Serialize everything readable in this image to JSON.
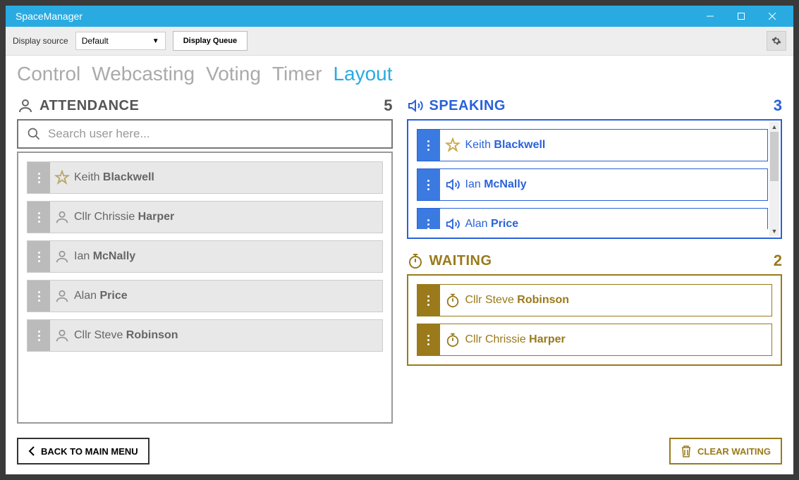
{
  "window": {
    "title": "SpaceManager"
  },
  "toolbar": {
    "display_source_label": "Display source",
    "display_source_value": "Default",
    "display_queue_label": "Display Queue"
  },
  "tabs": [
    "Control",
    "Webcasting",
    "Voting",
    "Timer",
    "Layout"
  ],
  "active_tab": 4,
  "attendance": {
    "title": "ATTENDANCE",
    "count": "5",
    "search_placeholder": "Search user here...",
    "items": [
      {
        "icon": "star",
        "first": "Keith",
        "last": "Blackwell"
      },
      {
        "icon": "person",
        "first": "Cllr Chrissie",
        "last": "Harper"
      },
      {
        "icon": "person",
        "first": "Ian",
        "last": "McNally"
      },
      {
        "icon": "person",
        "first": "Alan",
        "last": "Price"
      },
      {
        "icon": "person",
        "first": "Cllr Steve",
        "last": "Robinson"
      }
    ]
  },
  "speaking": {
    "title": "SPEAKING",
    "count": "3",
    "items": [
      {
        "icon": "star",
        "first": "Keith",
        "last": "Blackwell"
      },
      {
        "icon": "speaker",
        "first": "Ian",
        "last": "McNally"
      },
      {
        "icon": "speaker",
        "first": "Alan",
        "last": "Price"
      }
    ]
  },
  "waiting": {
    "title": "WAITING",
    "count": "2",
    "items": [
      {
        "icon": "timer",
        "first": "Cllr Steve",
        "last": "Robinson"
      },
      {
        "icon": "timer",
        "first": "Cllr Chrissie",
        "last": "Harper"
      }
    ]
  },
  "footer": {
    "back_label": "BACK TO MAIN MENU",
    "clear_label": "CLEAR WAITING"
  },
  "colors": {
    "accent": "#29abe2",
    "blue": "#2962d9",
    "brown": "#9a7a1b"
  }
}
